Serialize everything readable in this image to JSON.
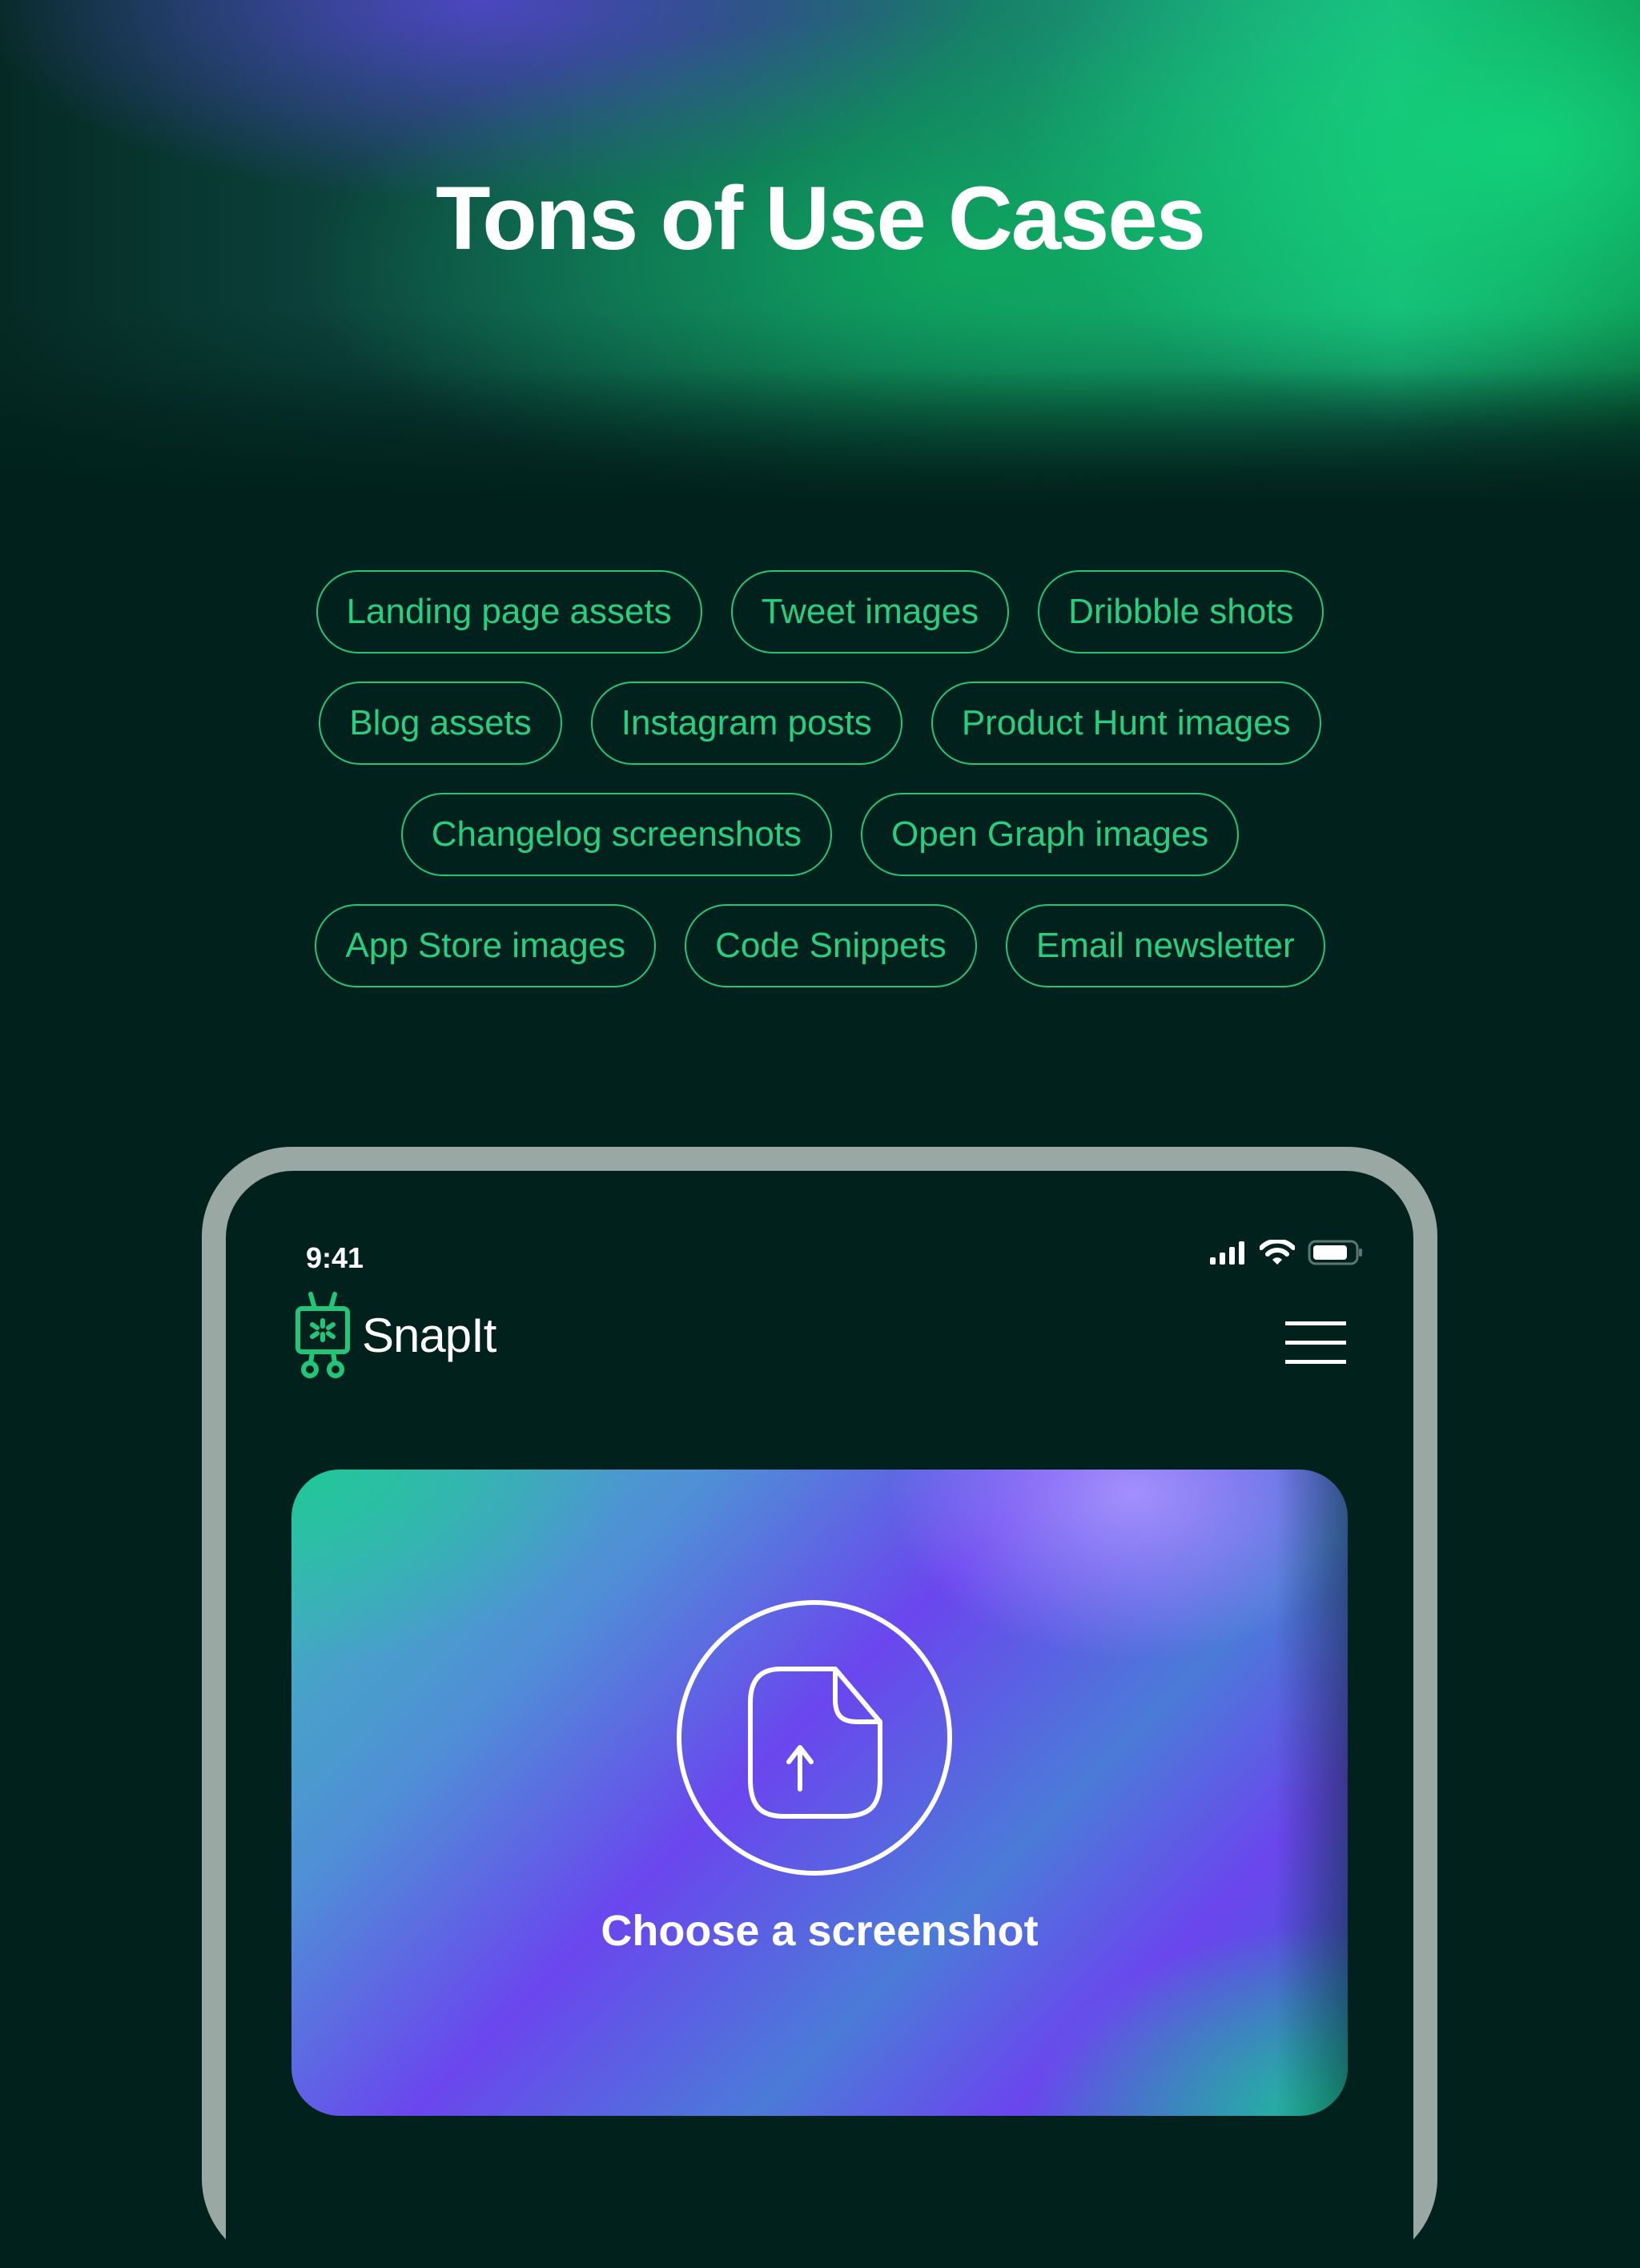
{
  "hero": {
    "title": "Tons of Use Cases"
  },
  "use_cases": {
    "rows": [
      [
        "Landing page assets",
        "Tweet images",
        "Dribbble shots"
      ],
      [
        "Blog assets",
        "Instagram posts",
        "Product Hunt images"
      ],
      [
        "Changelog screenshots",
        "Open Graph images"
      ],
      [
        "App Store images",
        "Code Snippets",
        "Email newsletter"
      ]
    ]
  },
  "phone": {
    "status_bar": {
      "time": "9:41",
      "icons": [
        "cellular-signal-icon",
        "wifi-icon",
        "battery-icon"
      ]
    },
    "app": {
      "brand_name": "SnapIt",
      "logo_icon": "tv-robot-logo-icon",
      "menu_icon": "hamburger-menu-icon",
      "upload": {
        "icon": "file-upload-icon",
        "label": "Choose a screenshot"
      }
    }
  },
  "colors": {
    "background": "#01221c",
    "accent_green": "#22c67a",
    "frame": "#9aa8a3",
    "purple": "#6a46ee"
  }
}
